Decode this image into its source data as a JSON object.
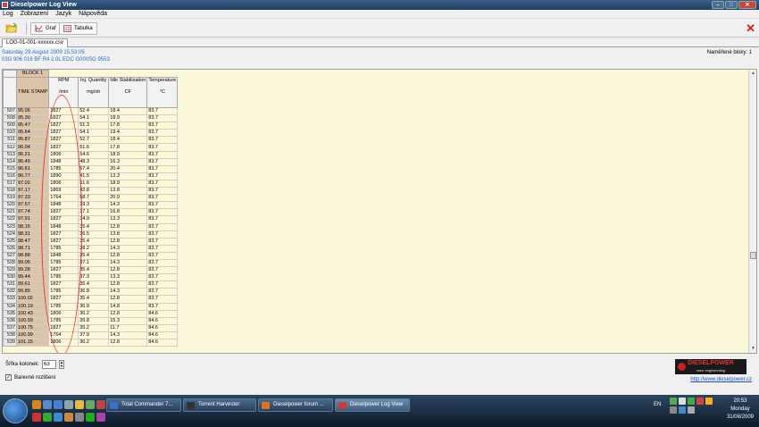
{
  "window": {
    "title": "Dieselpower Log View",
    "controls": [
      "–",
      "□",
      "✕"
    ]
  },
  "menu": [
    "Log",
    "Zobrazení",
    "Jazyk",
    "Nápověda"
  ],
  "toolbar": {
    "graph_label": "Graf",
    "table_label": "Tabulka"
  },
  "tab": {
    "label": "LOG-01-001-xxxxxx.csv"
  },
  "info": {
    "date": "Saturday 29.August 2009 15:53:05",
    "ecu": "03G 906 016 BF  R4 2.0L EDC G000SG  9553"
  },
  "blocks_label": "Naměřené bloky: 1",
  "grid": {
    "block_label": "BLOCK 1",
    "headers": [
      {
        "name": "TIME STAMP",
        "unit": ""
      },
      {
        "name": "RPM",
        "unit": "/min"
      },
      {
        "name": "Inj. Quantity",
        "unit": "mg/str"
      },
      {
        "name": "Idle Stabilization",
        "unit": "CF"
      },
      {
        "name": "Temperature",
        "unit": "°C"
      }
    ],
    "rows": [
      [
        "507",
        "95.06",
        "1827",
        "52.4",
        "18.4",
        "83.7"
      ],
      [
        "508",
        "95.30",
        "1827",
        "54.1",
        "18.9",
        "83.7"
      ],
      [
        "509",
        "95.47",
        "1827",
        "51.3",
        "17.8",
        "83.7"
      ],
      [
        "510",
        "95.64",
        "1827",
        "54.1",
        "19.4",
        "83.7"
      ],
      [
        "511",
        "95.87",
        "1827",
        "52.7",
        "18.4",
        "83.7"
      ],
      [
        "512",
        "96.04",
        "1827",
        "51.6",
        "17.8",
        "83.7"
      ],
      [
        "513",
        "96.21",
        "1806",
        "54.6",
        "18.9",
        "83.7"
      ],
      [
        "514",
        "96.45",
        "1848",
        "48.3",
        "16.3",
        "83.7"
      ],
      [
        "515",
        "96.61",
        "1785",
        "57.4",
        "20.4",
        "83.7"
      ],
      [
        "516",
        "96.77",
        "1890",
        "41.5",
        "13.3",
        "83.7"
      ],
      [
        "517",
        "97.02",
        "1806",
        "51.6",
        "18.9",
        "83.7"
      ],
      [
        "518",
        "97.17",
        "1869",
        "42.8",
        "13.8",
        "83.7"
      ],
      [
        "519",
        "97.33",
        "1764",
        "58.7",
        "20.9",
        "83.7"
      ],
      [
        "520",
        "97.57",
        "1848",
        "39.3",
        "14.3",
        "83.7"
      ],
      [
        "521",
        "97.74",
        "1827",
        "37.1",
        "16.8",
        "83.7"
      ],
      [
        "522",
        "97.91",
        "1827",
        "34.9",
        "13.3",
        "83.7"
      ],
      [
        "523",
        "98.15",
        "1848",
        "35.4",
        "12.8",
        "83.7"
      ],
      [
        "524",
        "98.31",
        "1827",
        "36.5",
        "13.8",
        "83.7"
      ],
      [
        "525",
        "98.47",
        "1827",
        "35.4",
        "12.8",
        "83.7"
      ],
      [
        "526",
        "98.71",
        "1785",
        "38.2",
        "14.3",
        "83.7"
      ],
      [
        "527",
        "98.88",
        "1848",
        "35.4",
        "12.8",
        "83.7"
      ],
      [
        "528",
        "99.05",
        "1785",
        "37.1",
        "14.3",
        "83.7"
      ],
      [
        "529",
        "99.28",
        "1827",
        "35.4",
        "12.8",
        "83.7"
      ],
      [
        "530",
        "99.44",
        "1785",
        "37.3",
        "13.3",
        "83.7"
      ],
      [
        "531",
        "99.61",
        "1827",
        "35.4",
        "12.8",
        "83.7"
      ],
      [
        "532",
        "99.85",
        "1785",
        "36.8",
        "14.3",
        "83.7"
      ],
      [
        "533",
        "100.02",
        "1827",
        "35.4",
        "12.8",
        "83.7"
      ],
      [
        "534",
        "100.19",
        "1785",
        "36.9",
        "14.8",
        "83.7"
      ],
      [
        "535",
        "100.43",
        "1806",
        "36.2",
        "12.8",
        "84.6"
      ],
      [
        "536",
        "100.59",
        "1785",
        "39.8",
        "15.3",
        "84.6"
      ],
      [
        "537",
        "100.75",
        "1827",
        "35.2",
        "11.7",
        "84.6"
      ],
      [
        "538",
        "100.99",
        "1764",
        "37.9",
        "14.3",
        "84.6"
      ],
      [
        "539",
        "101.15",
        "1806",
        "36.2",
        "12.8",
        "84.6"
      ]
    ]
  },
  "bottom": {
    "column_width_label": "Šířka kolonek:",
    "column_width_value": "63",
    "color_checkbox_label": "Barevné rozlišení",
    "color_checkbox_checked": "✓",
    "logo_text": "DIESELPOWER",
    "logo_sub": "race engineering",
    "url": "http://www.dieselpower.cz"
  },
  "taskbar": {
    "buttons": [
      "Total Commander 7...",
      "Torrent Harvester",
      "Dieselpower forum ...",
      "Dieselpower Log View"
    ],
    "lang": "EN",
    "time": "20:53",
    "day": "Monday",
    "date": "31/08/2009"
  }
}
